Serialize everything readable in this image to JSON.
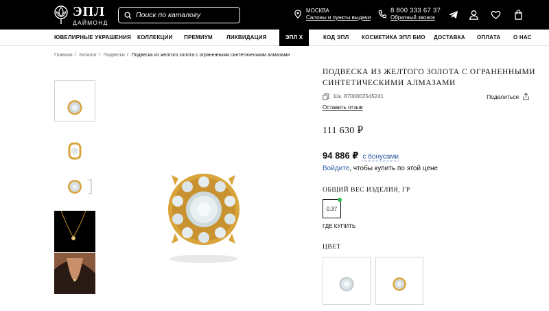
{
  "header": {
    "logo_main": "ЭПЛ",
    "logo_sub": "ДАЙМОНД",
    "search_placeholder": "Поиск по каталогу",
    "city": "МОСКВА",
    "stores_link": "Салоны и пункты выдачи",
    "phone": "8 800 333 67 37",
    "callback_link": "Обратный звонок"
  },
  "nav": [
    "ЮВЕЛИРНЫЕ УКРАШЕНИЯ",
    "КОЛЛЕКЦИИ",
    "ПРЕМИУМ",
    "ЛИКВИДАЦИЯ",
    "ЭПЛ X",
    "КОД ЭПЛ",
    "КОСМЕТИКА ЭПЛ БИО",
    "ДОСТАВКА",
    "ОПЛАТА",
    "О НАС"
  ],
  "breadcrumb": [
    "Главная",
    "Каталог",
    "Подвески",
    "Подвеска из желтого золота с ограненными синтетическими алмазами"
  ],
  "product": {
    "title": "Подвеска из желтого золота с ограненными синтетическими алмазами",
    "sku": "Шк. 8700002545241",
    "share_label": "Поделиться",
    "review_link": "Оставить отзыв",
    "old_price": "111 630 ₽",
    "new_price": "94 886 ₽",
    "bonus_link": "с бонусами",
    "login_link": "Войдите",
    "login_text": ", чтобы купить по этой цене",
    "weight_label": "Общий вес изделия, гр",
    "weight_value": "0.37",
    "where_buy": "ГДЕ КУПИТЬ",
    "color_label": "Цвет"
  },
  "colors": {
    "gold": "#d9a43a",
    "diamond": "#e6edf0",
    "link": "#2c5aa0",
    "in_stock_dot": "#2dbb4e"
  },
  "icons": [
    "logo-flower-icon",
    "search-icon",
    "location-pin-icon",
    "phone-icon",
    "telegram-icon",
    "user-icon",
    "heart-icon",
    "cart-icon",
    "copy-icon",
    "share-icon"
  ]
}
